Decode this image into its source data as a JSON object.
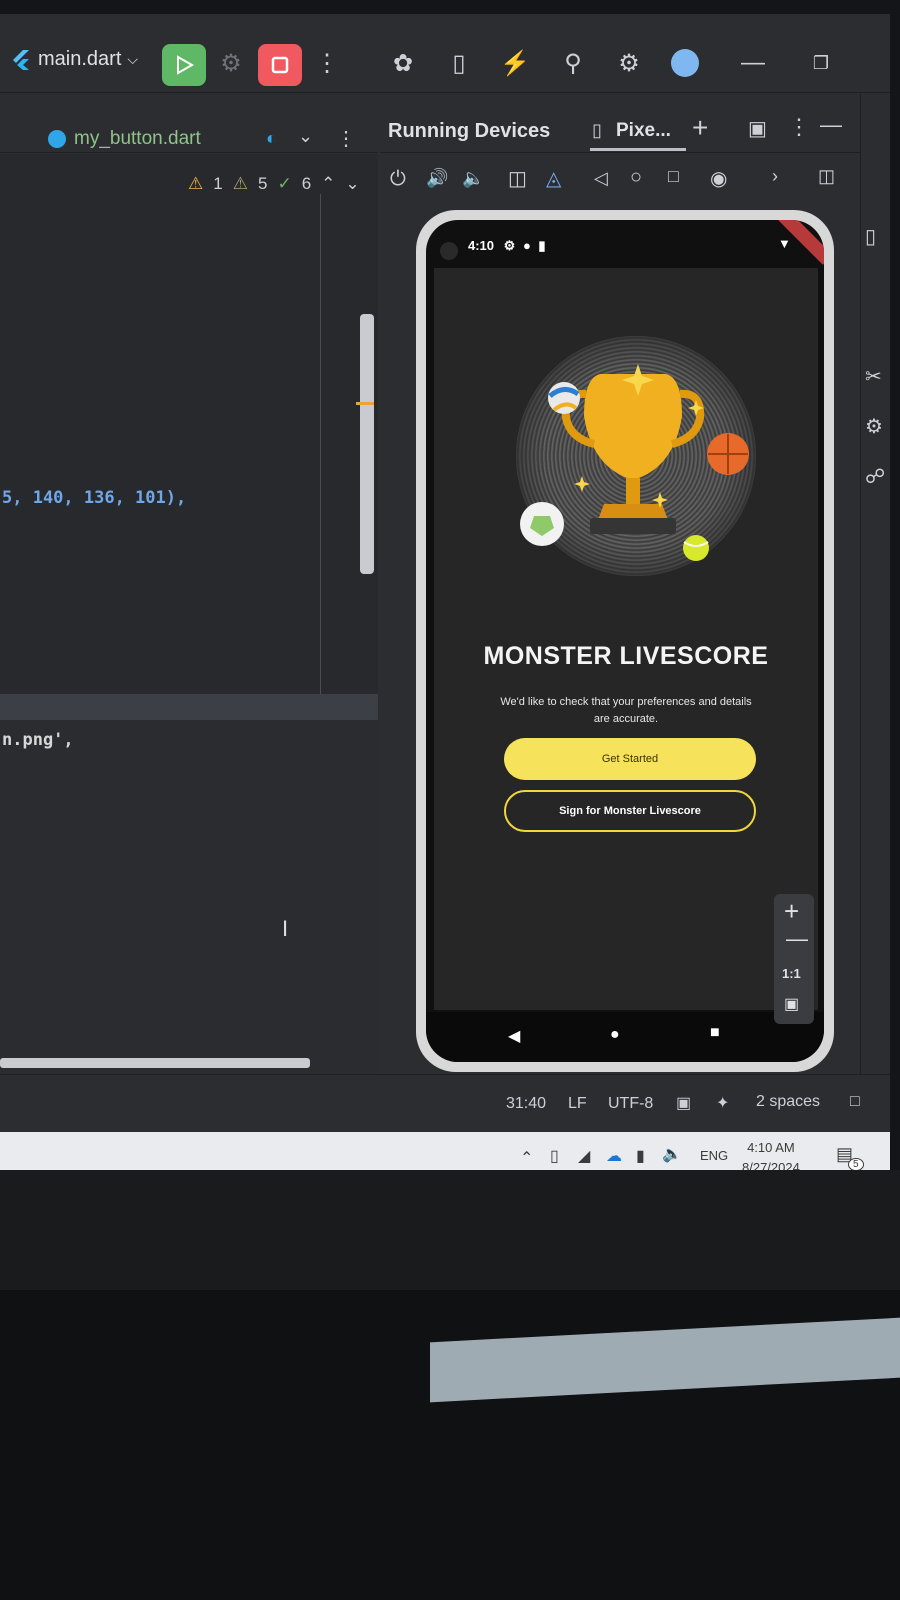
{
  "toolbar": {
    "run_config": "main.dart",
    "icons": [
      "flutter-icon",
      "chevron-down-icon",
      "run-icon",
      "debug-bug-icon",
      "stop-icon",
      "more-vertical-icon",
      "bug-report-icon",
      "device-manager-icon",
      "flash-icon",
      "search-icon",
      "settings-icon",
      "account-icon",
      "minimize-icon",
      "restore-icon"
    ]
  },
  "editor": {
    "tab_label": "my_button.dart",
    "warnings": {
      "w1": "1",
      "w2": "5",
      "w3": "6"
    },
    "code_line_1": "5, 140, 136, 101),",
    "code_line_2": "n.png',"
  },
  "panel": {
    "title": "Running Devices",
    "device_tab": "Pixe..."
  },
  "device": {
    "status_time": "4:10",
    "app_title": "MONSTER LIVESCORE",
    "subtitle": "We'd like to check that your preferences and details are accurate.",
    "primary_button": "Get Started",
    "secondary_button": "Sign for Monster Livescore",
    "zoom_label": "1:1",
    "accent": "#f7e25b"
  },
  "statusbar": {
    "position": "31:40",
    "line_sep": "LF",
    "encoding": "UTF-8",
    "indent": "2 spaces"
  },
  "taskbar": {
    "lang": "ENG",
    "time": "4:10 AM",
    "date": "8/27/2024",
    "notif_count": "5"
  }
}
